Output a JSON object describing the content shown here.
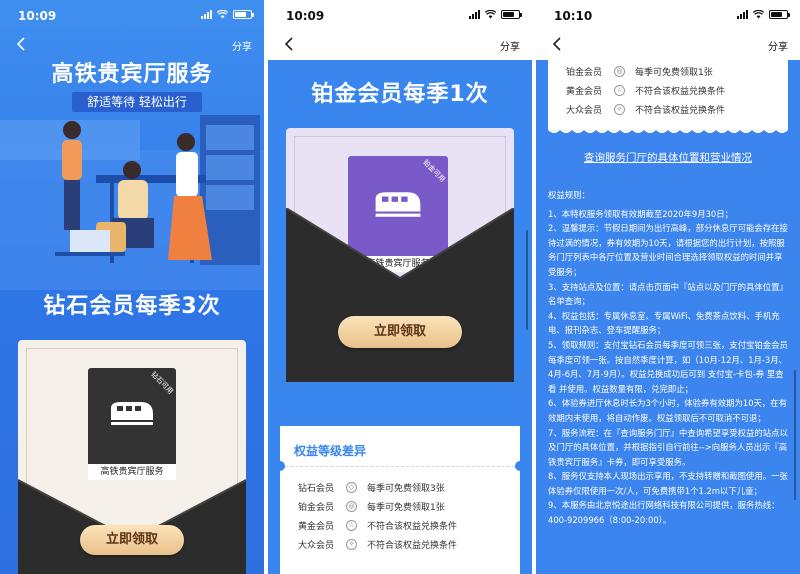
{
  "status": {
    "time1": "10:09",
    "time2": "10:09",
    "time3": "10:10"
  },
  "nav": {
    "share_label": "分享"
  },
  "panel1": {
    "hero_title": "高铁贵宾厅服务",
    "hero_subtitle": "舒适等待 轻松出行",
    "member_title": "钻石会员每季3次",
    "ticket_label": "高铁贵宾厅服务",
    "ribbon": "钻石可用",
    "claim_button": "立即领取"
  },
  "panel2": {
    "member_title": "铂金会员每季1次",
    "ticket_label": "高铁贵宾厅服务",
    "ribbon": "铂金可用",
    "claim_button": "立即领取",
    "benefit_title": "权益等级差异",
    "benefits": [
      {
        "level": "钻石会员",
        "icon": "diamond-icon",
        "glyph": "◇",
        "desc": "每季可免费领取3张"
      },
      {
        "level": "铂金会员",
        "icon": "platinum-icon",
        "glyph": "◎",
        "desc": "每季可免费领取1张"
      },
      {
        "level": "黄金会员",
        "icon": "gold-icon",
        "glyph": "☆",
        "desc": "不符合该权益兑换条件"
      },
      {
        "level": "大众会员",
        "icon": "regular-icon",
        "glyph": "✧",
        "desc": "不符合该权益兑换条件"
      }
    ]
  },
  "panel3": {
    "benefits": [
      {
        "level": "铂金会员",
        "icon": "platinum-icon",
        "glyph": "◎",
        "desc": "每季可免费领取1张"
      },
      {
        "level": "黄金会员",
        "icon": "gold-icon",
        "glyph": "☆",
        "desc": "不符合该权益兑换条件"
      },
      {
        "level": "大众会员",
        "icon": "regular-icon",
        "glyph": "✧",
        "desc": "不符合该权益兑换条件"
      }
    ],
    "store_link": "查询服务门厅的具体位置和营业情况",
    "rules_title": "权益规则：",
    "rules": [
      "1、本特权服务领取有效期截至2020年9月30日；",
      "2、温馨提示：节假日期间为出行高峰，部分休息厅可能会存在接待过满的情况，券有效期为10天，请根据您的出行计划，按照服务门厅列表中各厅位置及营业时间合理选择领取权益的时间并享受服务；",
      "3、支持站点及位置：请点击页面中『站点以及门厅的具体位置』名单查询；",
      "4、权益包括：专属休息室、专属WiFi、免费茶点饮料、手机充电、报刊杂志、登车提醒服务；",
      "5、领取规则：支付宝钻石会员每季度可领三张，支付宝铂金会员每季度可领一张。按自然季度计算，如（10月-12月、1月-3月、4月-6月、7月-9月）。权益兑换成功后可到 支付宝-卡包-券 里查看 并使用。权益数量有限，兑完即止；",
      "6、体验券进厅休息时长为3个小时，体验券有效期为10天，在有效期内未使用，将自动作废。权益领取后不可取消不可退；",
      "7、服务流程：在『查询服务门厅』中查询希望享受权益的站点以及门厅的具体位置，并根据指引自行前往-->向服务人员出示『高铁贵宾厅服务』卡券，即可享受服务。",
      "8、服务仅支持本人现场出示享用，不支持转赠和截图使用。一张体验券仅限使用一次/人，可免费携带1个1.2m以下儿童；",
      "9、本服务由北京悦途出行网络科技有限公司提供，服务热线：400-9209966（8:00-20:00）。"
    ]
  }
}
